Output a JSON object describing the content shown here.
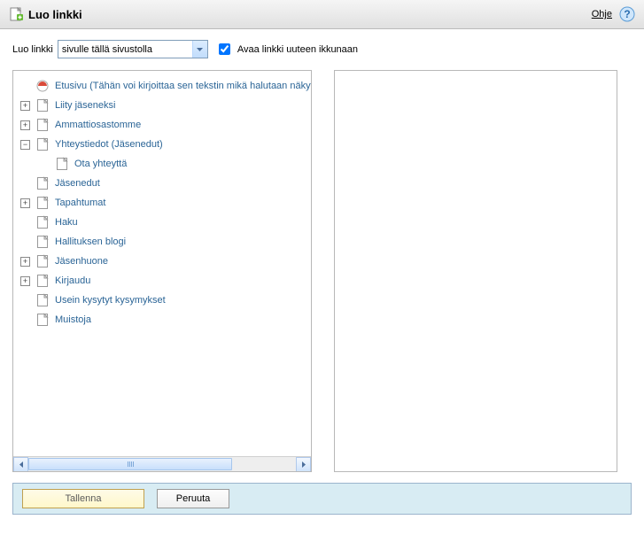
{
  "header": {
    "title": "Luo linkki",
    "help": "Ohje"
  },
  "toolbar": {
    "label": "Luo linkki",
    "select_value": "sivulle tällä sivustolla",
    "new_window": "Avaa linkki uuteen ikkunaan"
  },
  "tree": [
    {
      "depth": 0,
      "exp": "",
      "icon": "home",
      "label": "Etusivu (Tähän voi kirjoittaa sen tekstin mikä halutaan näkyvän)"
    },
    {
      "depth": 0,
      "exp": "+",
      "icon": "file",
      "label": "Liity jäseneksi"
    },
    {
      "depth": 0,
      "exp": "+",
      "icon": "file",
      "label": "Ammattiosastomme"
    },
    {
      "depth": 0,
      "exp": "-",
      "icon": "file",
      "label": "Yhteystiedot (Jäsenedut)"
    },
    {
      "depth": 1,
      "exp": "",
      "icon": "file",
      "label": "Ota yhteyttä"
    },
    {
      "depth": 0,
      "exp": "",
      "icon": "file",
      "label": "Jäsenedut"
    },
    {
      "depth": 0,
      "exp": "+",
      "icon": "file",
      "label": "Tapahtumat"
    },
    {
      "depth": 0,
      "exp": "",
      "icon": "file",
      "label": "Haku"
    },
    {
      "depth": 0,
      "exp": "",
      "icon": "file",
      "label": "Hallituksen blogi"
    },
    {
      "depth": 0,
      "exp": "+",
      "icon": "file",
      "label": "Jäsenhuone"
    },
    {
      "depth": 0,
      "exp": "+",
      "icon": "file",
      "label": "Kirjaudu"
    },
    {
      "depth": 0,
      "exp": "",
      "icon": "file",
      "label": "Usein kysytyt kysymykset"
    },
    {
      "depth": 0,
      "exp": "",
      "icon": "file",
      "label": "Muistoja"
    }
  ],
  "footer": {
    "save": "Tallenna",
    "cancel": "Peruuta"
  }
}
